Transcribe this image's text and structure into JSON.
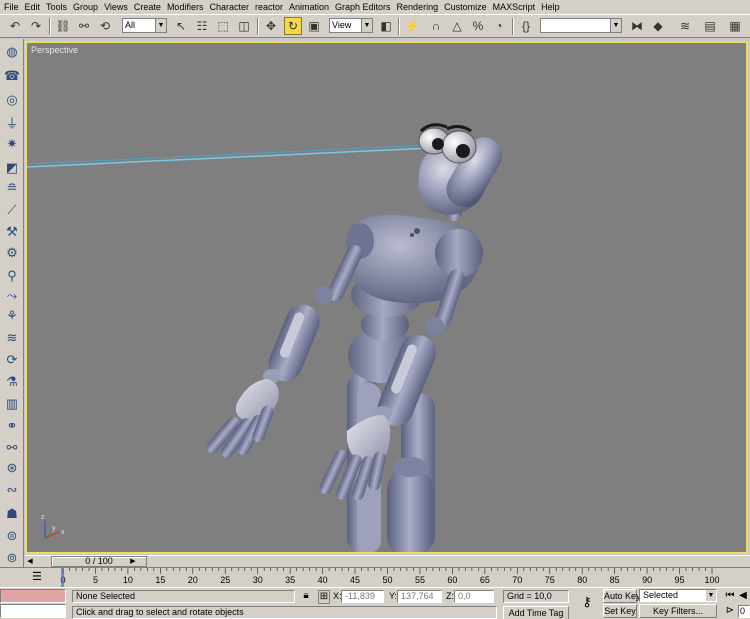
{
  "menu": [
    "File",
    "Edit",
    "Tools",
    "Group",
    "Views",
    "Create",
    "Modifiers",
    "Character",
    "reactor",
    "Animation",
    "Graph Editors",
    "Rendering",
    "Customize",
    "MAXScript",
    "Help"
  ],
  "toolbar": {
    "selection_filter": "All",
    "reference_coord": "View",
    "named_selection": ""
  },
  "viewport": {
    "label": "Perspective",
    "axis_x": "x",
    "axis_y": "y",
    "axis_z": "z"
  },
  "time": {
    "slider_label": "0 / 100",
    "frames": [
      "0",
      "5",
      "10",
      "15",
      "20",
      "25",
      "30",
      "35",
      "40",
      "45",
      "50",
      "55",
      "60",
      "65",
      "70",
      "75",
      "80",
      "85",
      "90",
      "95",
      "100"
    ]
  },
  "status": {
    "selection": "None Selected",
    "prompt": "Click and drag to select and rotate objects",
    "x_label": "X:",
    "x_value": "-11,839",
    "y_label": "Y:",
    "y_value": "137,764",
    "z_label": "Z:",
    "z_value": "0,0",
    "grid": "Grid = 10,0",
    "add_time_tag": "Add Time Tag",
    "auto_key": "Auto Key",
    "set_key": "Set Key",
    "key_mode": "Selected",
    "key_filters": "Key Filters...",
    "current_frame": "0"
  },
  "colors": {
    "viewport_bg": "#7f7f7f",
    "viewport_border": "#f0dc60",
    "character": "#8a8fab",
    "bone_link": "#7ec6e6"
  }
}
